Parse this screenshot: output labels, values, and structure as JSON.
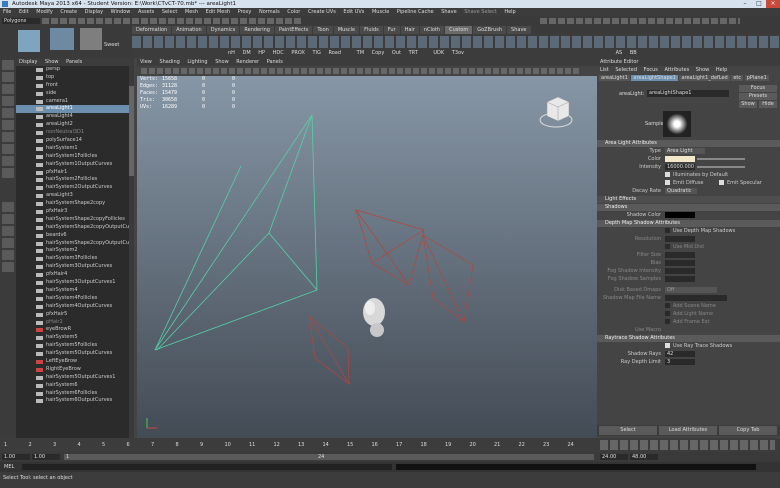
{
  "window": {
    "title": "Autodesk Maya 2013 x64 - Student Version: E:\\Work\\CTvCT-70.mb* --- areaLight1"
  },
  "menubar": [
    "File",
    "Edit",
    "Modify",
    "Create",
    "Display",
    "Window",
    "Assets",
    "Select",
    "Mesh",
    "Edit Mesh",
    "Proxy",
    "Normals",
    "Color",
    "Create UVs",
    "Edit UVs",
    "Muscle",
    "Pipeline Cache",
    "Shave",
    "Shave Select",
    "Help"
  ],
  "mode_menu": "Polygons",
  "shelf_tabs": [
    "Deformation",
    "Animation",
    "Dynamics",
    "Rendering",
    "PaintEffects",
    "Toon",
    "Muscle",
    "Fluids",
    "Fur",
    "Hair",
    "nCloth",
    "Custom",
    "GoZBrush",
    "Shave"
  ],
  "shelf_labels": [
    "Sweet"
  ],
  "shelf_icon_labels": [
    "nH",
    "DM",
    "HP",
    "HDC",
    "PROX",
    "TIG",
    "Road",
    "TM",
    "Copy",
    "Out",
    "TRT",
    "UDK",
    "T3ov",
    "AS",
    "BB"
  ],
  "outliner": {
    "menu": [
      "Display",
      "Show",
      "Panels"
    ],
    "items": [
      {
        "label": "persp",
        "type": "camera"
      },
      {
        "label": "top",
        "type": "camera"
      },
      {
        "label": "front",
        "type": "camera"
      },
      {
        "label": "side",
        "type": "camera"
      },
      {
        "label": "camera1",
        "type": "camera"
      },
      {
        "label": "areaLight1",
        "type": "light",
        "selected": true
      },
      {
        "label": "areaLight4",
        "type": "light"
      },
      {
        "label": "areaLight2",
        "type": "light"
      },
      {
        "label": "nonNeutral3D1",
        "type": "dim"
      },
      {
        "label": "polySurface14",
        "type": "mesh"
      },
      {
        "label": "hairSystem1",
        "type": "hair"
      },
      {
        "label": "hairSystem1Follicles",
        "type": "hair"
      },
      {
        "label": "hairSystem1OutputCurves",
        "type": "hair"
      },
      {
        "label": "pfxHair1",
        "type": "hair"
      },
      {
        "label": "hairSystem2Follicles",
        "type": "hair"
      },
      {
        "label": "hairSystem2OutputCurves",
        "type": "hair"
      },
      {
        "label": "areaLight3",
        "type": "light"
      },
      {
        "label": "hairSystemShape2copy",
        "type": "hair"
      },
      {
        "label": "pfxHair3",
        "type": "hair"
      },
      {
        "label": "hairSystemShape2copyFollicles",
        "type": "hair"
      },
      {
        "label": "hairSystemShape2copyOutputCurves",
        "type": "hair"
      },
      {
        "label": "beardv6",
        "type": "hair"
      },
      {
        "label": "hairSystemShape2copyOutputCurves1",
        "type": "hair"
      },
      {
        "label": "hairSystem2",
        "type": "hair"
      },
      {
        "label": "hairSystem3Follicles",
        "type": "hair"
      },
      {
        "label": "hairSystem3OutputCurves",
        "type": "hair"
      },
      {
        "label": "pfxHair4",
        "type": "hair"
      },
      {
        "label": "hairSystem3OutputCurves1",
        "type": "hair"
      },
      {
        "label": "hairSystem4",
        "type": "hair"
      },
      {
        "label": "hairSystem4Follicles",
        "type": "hair"
      },
      {
        "label": "hairSystem4OutputCurves",
        "type": "hair"
      },
      {
        "label": "pfxHair5",
        "type": "hair"
      },
      {
        "label": "pHair1",
        "type": "dim"
      },
      {
        "label": "eyeBrowR",
        "type": "curve"
      },
      {
        "label": "hairSystem5",
        "type": "hair"
      },
      {
        "label": "hairSystem5Follicles",
        "type": "hair"
      },
      {
        "label": "hairSystem5OutputCurves",
        "type": "hair"
      },
      {
        "label": "LeftEyeBrow",
        "type": "curve"
      },
      {
        "label": "RightEyeBrow",
        "type": "curve"
      },
      {
        "label": "hairSystem5OutputCurves1",
        "type": "hair"
      },
      {
        "label": "hairSystem6",
        "type": "hair"
      },
      {
        "label": "hairSystem6Follicles",
        "type": "hair"
      },
      {
        "label": "hairSystem6OutputCurves",
        "type": "hair"
      }
    ]
  },
  "viewport": {
    "menu": [
      "View",
      "Shading",
      "Lighting",
      "Show",
      "Renderer",
      "Panels"
    ],
    "hud": [
      {
        "label": "Verts:",
        "a": "15658",
        "b": "0",
        "c": "0"
      },
      {
        "label": "Edges:",
        "a": "31128",
        "b": "0",
        "c": "0"
      },
      {
        "label": "Faces:",
        "a": "15479",
        "b": "0",
        "c": "0"
      },
      {
        "label": "Tris:",
        "a": "30658",
        "b": "0",
        "c": "0"
      },
      {
        "label": "UVs:",
        "a": "16289",
        "b": "0",
        "c": "0"
      }
    ],
    "colors": {
      "selected_light": "#55d1a8",
      "lights": "#b4453a"
    }
  },
  "attribute_editor": {
    "header": "Attribute Editor",
    "tabs": [
      "List",
      "Selected",
      "Focus",
      "Attributes",
      "Show",
      "Help"
    ],
    "node_tabs": [
      "areaLight1",
      "areaLightShape1",
      "areaLight1_defLed",
      "etc",
      "pPlane1"
    ],
    "focus_label": "Focus",
    "presets_label": "Presets",
    "show_label": "Show",
    "hide_label": "Hide",
    "node_label": "areaLight:",
    "node_value": "areaLightShape1",
    "sample_label": "Sample",
    "sections": {
      "area": "Area Light Attributes",
      "effects": "Light Effects",
      "shadows": "Shadows",
      "depthmap": "Depth Map Shadow Attributes",
      "raytrace": "Raytrace Shadow Attributes"
    },
    "type_label": "Type",
    "type_value": "Area Light",
    "color_label": "Color",
    "intensity_label": "Intensity",
    "intensity_value": "16000.000",
    "illum_default": "Illuminates by Default",
    "emit_diffuse": "Emit Diffuse",
    "emit_specular": "Emit Specular",
    "decay_label": "Decay Rate",
    "decay_value": "Quadratic",
    "shadow_color_label": "Shadow Color",
    "use_depth_map": "Use Depth Map Shadows",
    "resolution_label": "Resolution",
    "use_mid_dist": "Use Mid Dist",
    "filter_size_label": "Filter Size",
    "bias_label": "Bias",
    "fog_intensity_label": "Fog Shadow Intensity",
    "fog_samples_label": "Fog Shadow Samples",
    "disk_label": "Disk Based Dmaps",
    "disk_value": "Off",
    "shadow_map_label": "Shadow Map File Name",
    "add_scene_name": "Add Scene Name",
    "add_light_name": "Add Light Name",
    "add_frame_ext": "Add Frame Ext",
    "use_macro": "Use Macro",
    "use_raytrace": "Use Ray Trace Shadows",
    "shadow_rays_label": "Shadow Rays",
    "shadow_rays_value": "42",
    "ray_depth_label": "Ray Depth Limit",
    "ray_depth_value": "3",
    "buttons": [
      "Select",
      "Load Attributes",
      "Copy Tab"
    ]
  },
  "timeslider": {
    "ticks": [
      "1",
      "2",
      "3",
      "4",
      "5",
      "6",
      "7",
      "8",
      "9",
      "10",
      "11",
      "12",
      "13",
      "14",
      "15",
      "16",
      "17",
      "18",
      "19",
      "20",
      "21",
      "22",
      "23",
      "24"
    ]
  },
  "range": {
    "start": "1.00",
    "start2": "1.00",
    "range_start": "1",
    "range_end": "24",
    "end": "24.00",
    "end2": "48.00"
  },
  "cmdline": {
    "label": "MEL"
  },
  "helpline": {
    "text": "Select Tool: select an object"
  }
}
